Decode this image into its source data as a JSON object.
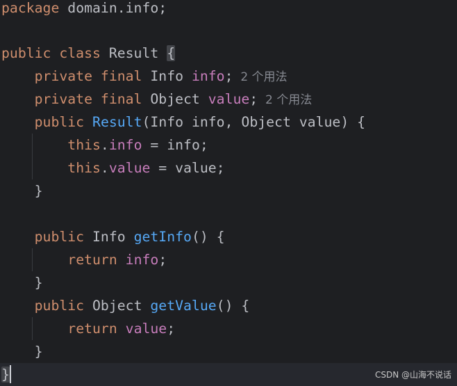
{
  "code": {
    "l1": {
      "kw": "package",
      "text": " domain.info;"
    },
    "l3": {
      "kw": "public class",
      "text": " Result ",
      "brace": "{"
    },
    "l4": {
      "indent": "    ",
      "kw": "private final",
      "type": " Info ",
      "field": "info",
      "semi": ";",
      "hint": "2 个用法"
    },
    "l5": {
      "indent": "    ",
      "kw": "private final",
      "type": " Object ",
      "field": "value",
      "semi": ";",
      "hint": "2 个用法"
    },
    "l6": {
      "indent": "    ",
      "kw": "public",
      "sp": " ",
      "fn": "Result",
      "params": "(Info info, Object value) {"
    },
    "l7": {
      "indent": "        ",
      "kw": "this",
      "dot": ".",
      "field": "info",
      "rest": " = info;"
    },
    "l8": {
      "indent": "        ",
      "kw": "this",
      "dot": ".",
      "field": "value",
      "rest": " = value;"
    },
    "l9": {
      "text": "    }"
    },
    "l11": {
      "indent": "    ",
      "kw": "public",
      "type": " Info ",
      "fn": "getInfo",
      "rest": "() {"
    },
    "l12": {
      "indent": "        ",
      "kw": "return",
      "sp": " ",
      "field": "info",
      "semi": ";"
    },
    "l13": {
      "text": "    }"
    },
    "l14": {
      "indent": "    ",
      "kw": "public",
      "type": " Object ",
      "fn": "getValue",
      "rest": "() {"
    },
    "l15": {
      "indent": "        ",
      "kw": "return",
      "sp": " ",
      "field": "value",
      "semi": ";"
    },
    "l16": {
      "text": "    }"
    },
    "l17": {
      "brace": "}"
    }
  },
  "watermark": "CSDN @山海不说话",
  "colors": {
    "background": "#1e1f22",
    "keyword": "#cf8e6d",
    "field": "#c77dbb",
    "function": "#56a8f5",
    "text": "#bcbec4",
    "hint": "#868991"
  }
}
